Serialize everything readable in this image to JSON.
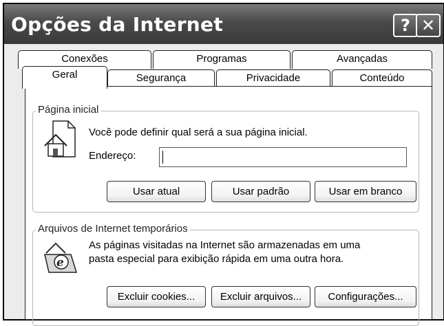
{
  "window": {
    "title": "Opções da Internet",
    "help_label": "?",
    "close_label": "✕"
  },
  "tabs": {
    "row_back": [
      "Conexões",
      "Programas",
      "Avançadas"
    ],
    "row_front": [
      "Geral",
      "Segurança",
      "Privacidade",
      "Conteúdo"
    ],
    "active": "Geral"
  },
  "home_page": {
    "group_label": "Página inicial",
    "description": "Você pode definir qual será a sua página inicial.",
    "address_label": "Endereço:",
    "address_value": "",
    "buttons": [
      "Usar atual",
      "Usar padrão",
      "Usar em branco"
    ]
  },
  "temp_files": {
    "group_label": "Arquivos de Internet temporários",
    "description_line1": "As páginas visitadas na Internet são armazenadas em uma",
    "description_line2": "pasta especial para exibição rápida em uma outra hora.",
    "buttons": [
      "Excluir cookies...",
      "Excluir arquivos...",
      "Configurações..."
    ]
  },
  "icons": {
    "home": "house-page-icon",
    "temp": "ie-folder-icon"
  }
}
